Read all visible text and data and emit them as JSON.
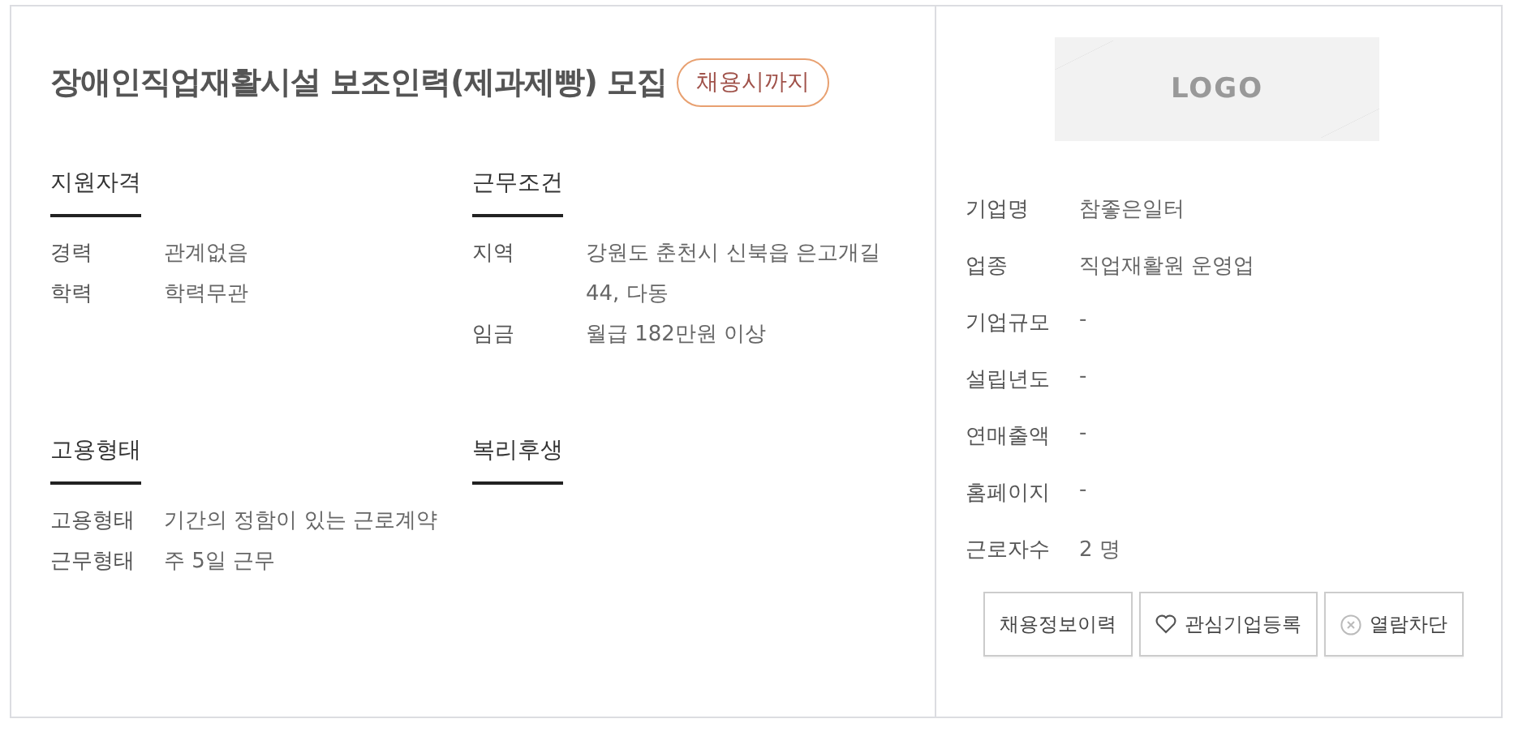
{
  "job": {
    "title": "장애인직업재활시설 보조인력(제과제빵) 모집",
    "deadline_badge": "채용시까지"
  },
  "sections": [
    {
      "heading": "지원자격",
      "rows": [
        {
          "label": "경력",
          "value": "관계없음"
        },
        {
          "label": "학력",
          "value": "학력무관"
        }
      ]
    },
    {
      "heading": "근무조건",
      "rows": [
        {
          "label": "지역",
          "value": "강원도 춘천시 신북읍 은고개길 44, 다동"
        },
        {
          "label": "임금",
          "value": "월급 182만원 이상"
        }
      ]
    },
    {
      "heading": "고용형태",
      "rows": [
        {
          "label": "고용형태",
          "value": "기간의 정함이 있는 근로계약"
        },
        {
          "label": "근무형태",
          "value": "주 5일 근무"
        }
      ]
    },
    {
      "heading": "복리후생"
    }
  ],
  "company": {
    "logo": "LOGO",
    "rows": [
      {
        "label": "기업명",
        "value": "참좋은일터"
      },
      {
        "label": "업종",
        "value": "직업재활원 운영업"
      },
      {
        "label": "기업규모",
        "value": "-"
      },
      {
        "label": "설립년도",
        "value": "-"
      },
      {
        "label": "연매출액",
        "value": "-"
      },
      {
        "label": "홈페이지",
        "value": "-"
      },
      {
        "label": "근로자수",
        "value": "2 명"
      }
    ]
  },
  "buttons": [
    {
      "label": "채용정보이력",
      "kind": "plain"
    },
    {
      "label": "관심기업등록",
      "kind": "favorite"
    },
    {
      "label": "열람차단",
      "kind": "block"
    }
  ]
}
